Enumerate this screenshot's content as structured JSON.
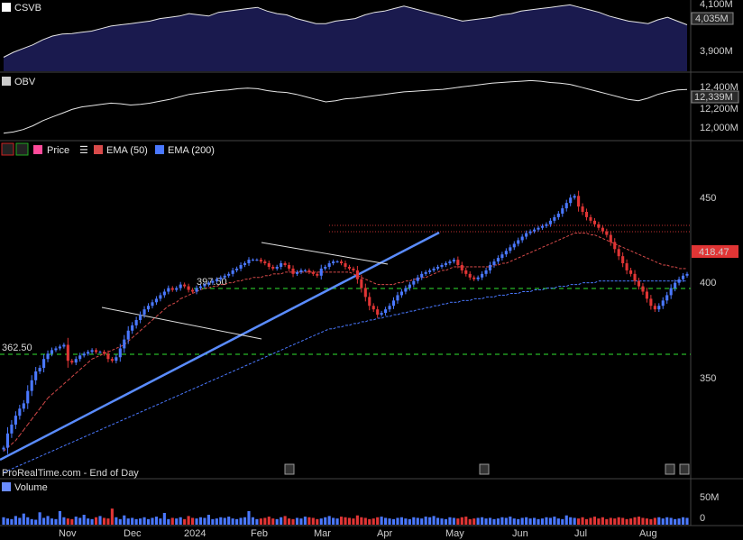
{
  "colors": {
    "background": "#000000",
    "up": "#4a78ff",
    "down": "#e03535",
    "ema50": "#d84a4a",
    "ema200": "#4a78ff",
    "trendline": "#5a8cff",
    "support": "#28b828",
    "resistance": "#c03030",
    "panel_line": "#e6e6e6",
    "csvb_fill": "#1a1a4e"
  },
  "csvb_panel": {
    "label": "CSVB",
    "ticks": [
      "4,100M",
      "3,900M"
    ],
    "last_value": "4,035M"
  },
  "obv_panel": {
    "label": "OBV",
    "ticks": [
      "12,400M",
      "12,200M",
      "12,000M"
    ],
    "last_value": "12,339M"
  },
  "price_panel": {
    "legend": {
      "price": "Price",
      "ema50": "EMA (50)",
      "ema200": "EMA (200)"
    },
    "y_ticks": [
      "450",
      "400",
      "350"
    ],
    "last_price": "418.47",
    "support_labels": [
      "397.50",
      "362.50"
    ],
    "watermark": "ProRealTime.com - End of Day"
  },
  "volume_panel": {
    "label": "Volume",
    "ticks": [
      "50M",
      "0"
    ]
  },
  "x_axis": {
    "labels": [
      "Nov",
      "Dec",
      "2024",
      "Feb",
      "Mar",
      "Apr",
      "May",
      "Jun",
      "Jul",
      "Aug"
    ]
  },
  "chart_data": [
    {
      "type": "line",
      "name": "CSVB",
      "y_range_M": [
        3860,
        4120
      ],
      "values_M": [
        3905,
        3925,
        3940,
        3955,
        3975,
        3990,
        3998,
        4000,
        4005,
        4010,
        4020,
        4030,
        4035,
        4040,
        4045,
        4050,
        4060,
        4065,
        4070,
        4080,
        4075,
        4070,
        4085,
        4090,
        4095,
        4100,
        4105,
        4090,
        4080,
        4075,
        4060,
        4050,
        4040,
        4040,
        4050,
        4055,
        4060,
        4075,
        4085,
        4090,
        4100,
        4110,
        4100,
        4090,
        4080,
        4070,
        4060,
        4050,
        4055,
        4060,
        4065,
        4075,
        4080,
        4090,
        4095,
        4100,
        4105,
        4110,
        4115,
        4105,
        4095,
        4085,
        4070,
        4060,
        4050,
        4045,
        4040,
        4055,
        4065,
        4050,
        4035
      ]
    },
    {
      "type": "line",
      "name": "OBV",
      "y_range_M": [
        11960,
        12420
      ],
      "values_M": [
        11990,
        12000,
        12020,
        12050,
        12090,
        12120,
        12150,
        12180,
        12200,
        12210,
        12220,
        12230,
        12225,
        12215,
        12220,
        12230,
        12245,
        12260,
        12280,
        12300,
        12310,
        12320,
        12330,
        12335,
        12345,
        12350,
        12345,
        12330,
        12320,
        12315,
        12300,
        12280,
        12260,
        12240,
        12250,
        12265,
        12270,
        12280,
        12290,
        12300,
        12310,
        12320,
        12325,
        12330,
        12335,
        12340,
        12350,
        12360,
        12370,
        12380,
        12390,
        12395,
        12400,
        12405,
        12410,
        12405,
        12395,
        12390,
        12380,
        12360,
        12340,
        12320,
        12300,
        12280,
        12260,
        12250,
        12270,
        12300,
        12320,
        12335,
        12339
      ]
    },
    {
      "type": "candlestick",
      "name": "Price",
      "y_range": [
        303,
        483
      ],
      "close": [
        320,
        328,
        333,
        338,
        342,
        345,
        352,
        358,
        363,
        365,
        370,
        373,
        375,
        376,
        377,
        378,
        369,
        368,
        370,
        372,
        373,
        374,
        375,
        374,
        374,
        373,
        370,
        369,
        371,
        376,
        381,
        386,
        389,
        392,
        395,
        398,
        400,
        402,
        404,
        406,
        408,
        410,
        409,
        410,
        412,
        411,
        409,
        408,
        410,
        411,
        412,
        413,
        414,
        415,
        416,
        417,
        418,
        420,
        421,
        423,
        424,
        426,
        426,
        426,
        425,
        424,
        422,
        421,
        422,
        424,
        423,
        421,
        418,
        419,
        420,
        420,
        419,
        418,
        417,
        421,
        422,
        424,
        425,
        425,
        424,
        422,
        421,
        420,
        415,
        410,
        405,
        400,
        398,
        395,
        396,
        398,
        400,
        403,
        406,
        408,
        410,
        412,
        414,
        416,
        418,
        419,
        420,
        421,
        422,
        423,
        424,
        425,
        426,
        423,
        420,
        418,
        416,
        415,
        416,
        418,
        420,
        423,
        425,
        427,
        429,
        431,
        433,
        435,
        437,
        439,
        441,
        442,
        443,
        444,
        445,
        446,
        448,
        450,
        452,
        455,
        458,
        461,
        462,
        456,
        453,
        450,
        448,
        446,
        444,
        442,
        440,
        436,
        432,
        428,
        424,
        420,
        418,
        414,
        411,
        408,
        404,
        400,
        398,
        400,
        403,
        406,
        410,
        413,
        415,
        417,
        418
      ]
    },
    {
      "type": "line",
      "name": "EMA (50)",
      "values": [
        318,
        320,
        322,
        324,
        327,
        330,
        333,
        336,
        339,
        342,
        345,
        348,
        350,
        352,
        354,
        356,
        358,
        360,
        362,
        364,
        366,
        368,
        370,
        371,
        372,
        373,
        374,
        375,
        376,
        377,
        378,
        380,
        382,
        384,
        386,
        388,
        390,
        392,
        394,
        396,
        398,
        400,
        401,
        402,
        404,
        405,
        406,
        407,
        408,
        409,
        410,
        410,
        411,
        411,
        412,
        412,
        413,
        413,
        414,
        414,
        415,
        415,
        416,
        416,
        416,
        417,
        417,
        418,
        418,
        418,
        419,
        419,
        419,
        419,
        419,
        419,
        419,
        419,
        419,
        419,
        419,
        419,
        419,
        419,
        419,
        419,
        419,
        418,
        417,
        416,
        415,
        414,
        413,
        412,
        412,
        412,
        412,
        412,
        413,
        413,
        414,
        414,
        415,
        415,
        416,
        416,
        417,
        418,
        419,
        420,
        420,
        421,
        422,
        422,
        422,
        422,
        422,
        422,
        422,
        422,
        422,
        422,
        423,
        423,
        424,
        424,
        425,
        426,
        427,
        428,
        429,
        430,
        431,
        432,
        433,
        434,
        435,
        436,
        437,
        438,
        439,
        440,
        441,
        441,
        441,
        441,
        440,
        440,
        439,
        438,
        437,
        436,
        435,
        434,
        433,
        432,
        431,
        430,
        429,
        428,
        427,
        426,
        425,
        424,
        423,
        423,
        422,
        422,
        421,
        421,
        421
      ]
    },
    {
      "type": "line",
      "name": "EMA (200)",
      "values": [
        306,
        307,
        308,
        309,
        310,
        311,
        312,
        313,
        314,
        315,
        316,
        317,
        318,
        319,
        320,
        321,
        322,
        323,
        324,
        325,
        326,
        327,
        328,
        329,
        330,
        331,
        332,
        333,
        334,
        335,
        336,
        337,
        338,
        339,
        340,
        341,
        342,
        343,
        344,
        345,
        346,
        347,
        348,
        349,
        350,
        351,
        352,
        353,
        354,
        355,
        356,
        357,
        358,
        359,
        360,
        361,
        362,
        363,
        364,
        365,
        366,
        367,
        368,
        369,
        370,
        371,
        372,
        373,
        374,
        375,
        376,
        377,
        378,
        379,
        380,
        381,
        382,
        383,
        384,
        385,
        386,
        387,
        387,
        388,
        388,
        389,
        389,
        390,
        390,
        391,
        391,
        392,
        392,
        393,
        393,
        394,
        394,
        395,
        395,
        396,
        396,
        397,
        397,
        398,
        398,
        399,
        399,
        400,
        400,
        401,
        401,
        402,
        402,
        402,
        403,
        403,
        403,
        404,
        404,
        404,
        405,
        405,
        405,
        406,
        406,
        406,
        407,
        407,
        407,
        408,
        408,
        408,
        409,
        409,
        409,
        410,
        410,
        410,
        411,
        411,
        411,
        412,
        412,
        412,
        413,
        413,
        413,
        413,
        414,
        414,
        414,
        414,
        414,
        414,
        414,
        414,
        414,
        414,
        414,
        414,
        414,
        414,
        414,
        414,
        414,
        414,
        414,
        414,
        414,
        414,
        414
      ]
    },
    {
      "type": "bar",
      "name": "Volume",
      "y_range_M": [
        0,
        70
      ],
      "values_M": [
        12,
        10,
        9,
        14,
        11,
        18,
        12,
        9,
        8,
        20,
        11,
        14,
        10,
        9,
        22,
        12,
        10,
        9,
        13,
        11,
        16,
        10,
        9,
        12,
        14,
        11,
        10,
        26,
        12,
        9,
        15,
        10,
        11,
        9,
        10,
        12,
        9,
        11,
        13,
        10,
        19,
        9,
        11,
        10,
        12,
        9,
        14,
        11,
        10,
        12,
        11,
        16,
        9,
        10,
        12,
        11,
        13,
        10,
        9,
        11,
        12,
        22,
        12,
        9,
        10,
        11,
        13,
        10,
        9,
        12,
        14,
        10,
        9,
        11,
        10,
        13,
        12,
        11,
        9,
        10,
        12,
        14,
        11,
        10,
        13,
        12,
        11,
        10,
        15,
        12,
        11,
        9,
        10,
        12,
        13,
        11,
        10,
        9,
        11,
        12,
        10,
        9,
        12,
        11,
        10,
        13,
        12,
        14,
        11,
        10,
        9,
        12,
        11,
        10,
        12,
        13,
        9,
        10,
        11,
        12,
        10,
        11,
        9,
        10,
        12,
        11,
        13,
        10,
        9,
        11,
        12,
        10,
        11,
        9,
        10,
        12,
        11,
        13,
        10,
        9,
        15,
        12,
        11,
        10,
        12,
        9,
        11,
        13,
        10,
        12,
        9,
        11,
        10,
        12,
        11,
        9,
        10,
        12,
        13,
        11,
        10,
        9,
        11,
        12,
        10,
        12,
        11,
        9,
        10,
        12,
        11
      ]
    }
  ]
}
